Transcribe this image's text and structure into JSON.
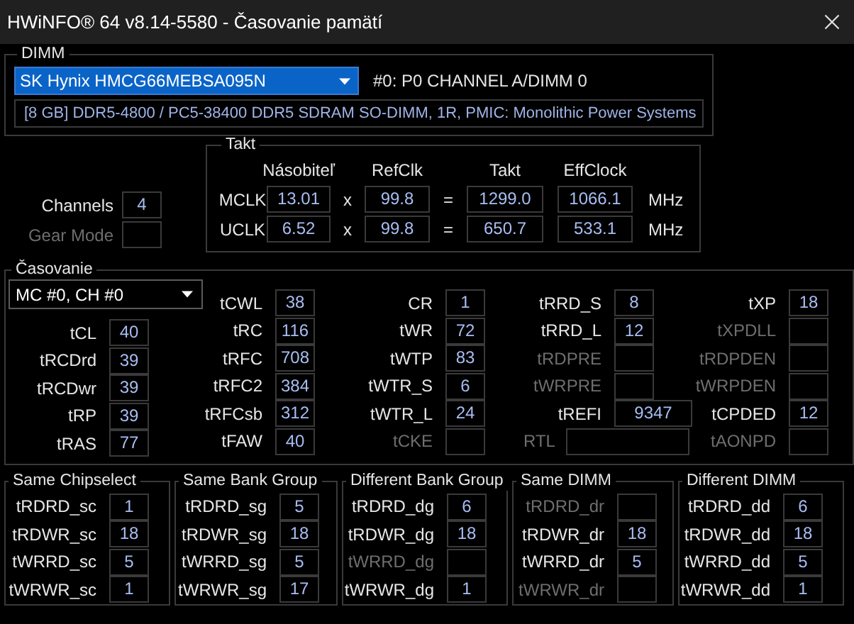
{
  "window": {
    "title": "HWiNFO® 64 v8.14-5580 - Časovanie pamätí"
  },
  "dimm": {
    "title": "DIMM",
    "module": "SK Hynix HMCG66MEBSA095N",
    "slot": "#0: P0 CHANNEL A/DIMM 0",
    "description": "[8 GB] DDR5-4800 / PC5-38400 DDR5 SDRAM SO-DIMM, 1R, PMIC: Monolithic Power Systems"
  },
  "general": [
    {
      "label": "Channels",
      "value": "4",
      "disabled": false
    },
    {
      "label": "Gear Mode",
      "disabled": true
    }
  ],
  "clock": {
    "title": "Takt",
    "columns": [
      "Násobiteľ",
      "RefClk",
      "Takt",
      "EffClock"
    ],
    "rows": [
      {
        "name": "MCLK",
        "multiplier": "13.01",
        "times": "x",
        "refclk": "99.8",
        "equals": "=",
        "clock": "1299.0",
        "effclock": "1066.1",
        "unit": "MHz"
      },
      {
        "name": "UCLK",
        "multiplier": "6.52",
        "times": "x",
        "refclk": "99.8",
        "equals": "=",
        "clock": "650.7",
        "effclock": "533.1",
        "unit": "MHz"
      }
    ]
  },
  "timings": {
    "title": "Časovanie",
    "channel": "MC #0, CH #0",
    "columns": [
      [
        {
          "label": "tCL",
          "value": "40",
          "disabled": false
        },
        {
          "label": "tRCDrd",
          "value": "39",
          "disabled": false
        },
        {
          "label": "tRCDwr",
          "value": "39",
          "disabled": false
        },
        {
          "label": "tRP",
          "value": "39",
          "disabled": false
        },
        {
          "label": "tRAS",
          "value": "77",
          "disabled": false
        }
      ],
      [
        {
          "label": "tCWL",
          "value": "38",
          "disabled": false
        },
        {
          "label": "tRC",
          "value": "116",
          "disabled": false
        },
        {
          "label": "tRFC",
          "value": "708",
          "disabled": false
        },
        {
          "label": "tRFC2",
          "value": "384",
          "disabled": false
        },
        {
          "label": "tRFCsb",
          "value": "312",
          "disabled": false
        },
        {
          "label": "tFAW",
          "value": "40",
          "disabled": false
        }
      ],
      [
        {
          "label": "CR",
          "value": "1",
          "disabled": false
        },
        {
          "label": "tWR",
          "value": "72",
          "disabled": false
        },
        {
          "label": "tWTP",
          "value": "83",
          "disabled": false
        },
        {
          "label": "tWTR_S",
          "value": "6",
          "disabled": false
        },
        {
          "label": "tWTR_L",
          "value": "24",
          "disabled": false
        },
        {
          "label": "tCKE",
          "disabled": true
        }
      ],
      [
        {
          "label": "tRRD_S",
          "value": "8",
          "disabled": false,
          "kind": "normal"
        },
        {
          "label": "tRRD_L",
          "value": "12",
          "disabled": false,
          "kind": "normal"
        },
        {
          "label": "tRDPRE",
          "disabled": true,
          "kind": "normal"
        },
        {
          "label": "tWRPRE",
          "disabled": true,
          "kind": "normal"
        },
        {
          "label": "tREFI",
          "value": "9347",
          "disabled": false,
          "kind": "wide"
        },
        {
          "label": "RTL",
          "disabled": true,
          "kind": "long"
        }
      ],
      [
        {
          "label": "tXP",
          "value": "18",
          "disabled": false
        },
        {
          "label": "tXPDLL",
          "disabled": true
        },
        {
          "label": "tRDPDEN",
          "disabled": true
        },
        {
          "label": "tWRPDEN",
          "disabled": true
        },
        {
          "label": "tCPDED",
          "value": "12",
          "disabled": false
        },
        {
          "label": "tAONPD",
          "disabled": true
        }
      ]
    ]
  },
  "groups": [
    {
      "title": "Same Chipselect",
      "rows": [
        {
          "label": "tRDRD_sc",
          "value": "1",
          "disabled": false
        },
        {
          "label": "tRDWR_sc",
          "value": "18",
          "disabled": false
        },
        {
          "label": "tWRRD_sc",
          "value": "5",
          "disabled": false
        },
        {
          "label": "tWRWR_sc",
          "value": "1",
          "disabled": false
        }
      ]
    },
    {
      "title": "Same Bank Group",
      "rows": [
        {
          "label": "tRDRD_sg",
          "value": "5",
          "disabled": false
        },
        {
          "label": "tRDWR_sg",
          "value": "18",
          "disabled": false
        },
        {
          "label": "tWRRD_sg",
          "value": "5",
          "disabled": false
        },
        {
          "label": "tWRWR_sg",
          "value": "17",
          "disabled": false
        }
      ]
    },
    {
      "title": "Different Bank Group",
      "rows": [
        {
          "label": "tRDRD_dg",
          "value": "6",
          "disabled": false
        },
        {
          "label": "tRDWR_dg",
          "value": "18",
          "disabled": false
        },
        {
          "label": "tWRRD_dg",
          "disabled": true
        },
        {
          "label": "tWRWR_dg",
          "value": "1",
          "disabled": false
        }
      ]
    },
    {
      "title": "Same DIMM",
      "rows": [
        {
          "label": "tRDRD_dr",
          "disabled": true
        },
        {
          "label": "tRDWR_dr",
          "value": "18",
          "disabled": false
        },
        {
          "label": "tWRRD_dr",
          "value": "5",
          "disabled": false
        },
        {
          "label": "tWRWR_dr",
          "disabled": true
        }
      ]
    },
    {
      "title": "Different DIMM",
      "rows": [
        {
          "label": "tRDRD_dd",
          "value": "6",
          "disabled": false
        },
        {
          "label": "tRDWR_dd",
          "value": "18",
          "disabled": false
        },
        {
          "label": "tWRRD_dd",
          "value": "5",
          "disabled": false
        },
        {
          "label": "tWRWR_dd",
          "value": "1",
          "disabled": false
        }
      ]
    }
  ]
}
